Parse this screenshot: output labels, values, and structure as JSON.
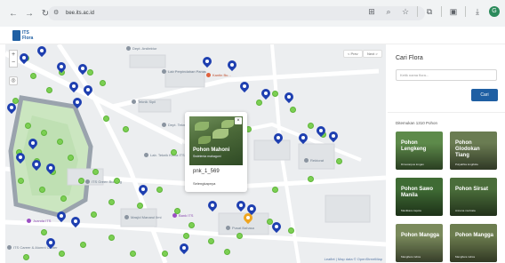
{
  "browser": {
    "url": "bee.its.ac.id",
    "icons": [
      "back-icon",
      "forward-icon",
      "reload-icon",
      "site-info-icon",
      "translate-icon",
      "zoom-icon",
      "star-icon",
      "extensions-icon",
      "tab-groups-icon",
      "downloads-icon",
      "profile-icon"
    ],
    "profile_initial": "G"
  },
  "site": {
    "logo_text_line1": "ITS",
    "logo_text_line2": "Flora"
  },
  "map": {
    "pager_prev": "< Prev",
    "pager_next": "Next >",
    "attribution": "Leaflet | Map data © OpenStreetMap",
    "pois": [
      {
        "label": "Dept. Arsitektur",
        "kind": "gray"
      },
      {
        "label": "Lab Perpindahan Panas",
        "kind": "gray"
      },
      {
        "label": "Kantin Bu...",
        "kind": "red"
      },
      {
        "label": "Teknik Sipil",
        "kind": "gray"
      },
      {
        "label": "Dept. Teknik Kimia",
        "kind": "gray"
      },
      {
        "label": "Lab. Teknik Kimia ITS",
        "kind": "gray"
      },
      {
        "label": "Rektorat",
        "kind": "gray"
      },
      {
        "label": "ITS Green Building",
        "kind": "gray"
      },
      {
        "label": "Masjid Manarul Ilmi",
        "kind": "gray"
      },
      {
        "label": "Bank ITS",
        "kind": "purple"
      },
      {
        "label": "Juanda ITS",
        "kind": "purple"
      },
      {
        "label": "ITS Career & Alumni Center",
        "kind": "gray"
      },
      {
        "label": "Pusat Bahasa",
        "kind": "gray"
      }
    ]
  },
  "popup": {
    "name": "Pohon Mahoni",
    "scientific": "Swietenia mahagoni",
    "id_label": "pnk_1_569",
    "more_link": "Selengkapnya",
    "close": "×"
  },
  "sidebar": {
    "title": "Cari Flora",
    "search_placeholder": "Ketik nama flora...",
    "search_button": "Cari",
    "count_text": "Ditemukan 1310 Pohon",
    "cards": [
      {
        "name": "Pohon Lengkeng",
        "sci": "Dimocarpus longan",
        "color": "#5d8a4a"
      },
      {
        "name": "Pohon Glodokan Tiang",
        "sci": "Polyalthia longifolia",
        "color": "#6a7c52"
      },
      {
        "name": "Pohon Sawo Manila",
        "sci": "Manilkara zapota",
        "color": "#3f6b34"
      },
      {
        "name": "Pohon Sirsat",
        "sci": "Annona muricata",
        "color": "#4a6d3a"
      },
      {
        "name": "Pohon Mangga",
        "sci": "Mangifera indica",
        "color": "#7a8a5c"
      },
      {
        "name": "Pohon Mangga",
        "sci": "Mangifera indica",
        "color": "#6c7d4f"
      }
    ]
  }
}
